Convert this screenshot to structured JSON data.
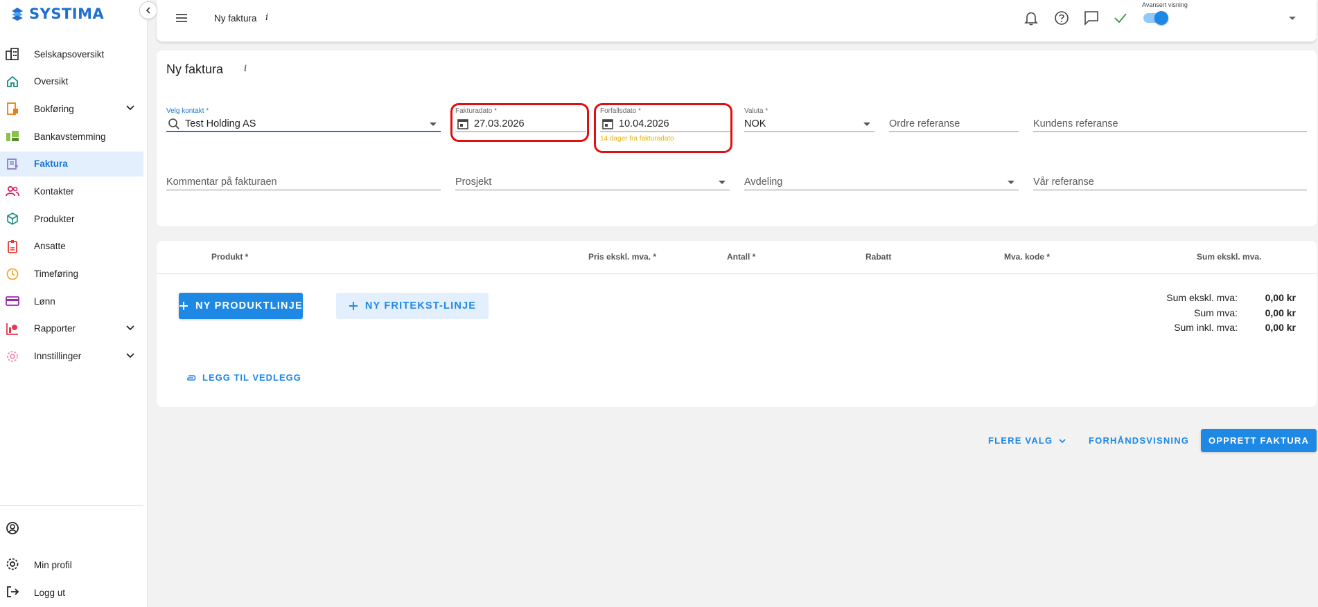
{
  "app": {
    "logo_text": "SYSTIMA"
  },
  "sidebar": {
    "items": [
      {
        "label": "Selskapsoversikt",
        "icon": "building-icon"
      },
      {
        "label": "Oversikt",
        "icon": "home-icon"
      },
      {
        "label": "Bokføring",
        "icon": "bookkeeping-icon",
        "expandable": true
      },
      {
        "label": "Bankavstemming",
        "icon": "bank-icon"
      },
      {
        "label": "Faktura",
        "icon": "invoice-icon",
        "active": true
      },
      {
        "label": "Kontakter",
        "icon": "contacts-icon"
      },
      {
        "label": "Produkter",
        "icon": "box-icon"
      },
      {
        "label": "Ansatte",
        "icon": "badge-icon"
      },
      {
        "label": "Timeføring",
        "icon": "clock-icon"
      },
      {
        "label": "Lønn",
        "icon": "card-icon"
      },
      {
        "label": "Rapporter",
        "icon": "reports-icon",
        "expandable": true
      },
      {
        "label": "Innstillinger",
        "icon": "settings-icon",
        "expandable": true
      }
    ],
    "bottom": {
      "profile_label": "Min profil",
      "logout_label": "Logg ut"
    }
  },
  "topbar": {
    "title": "Ny faktura",
    "info": "i",
    "toggle_label": "Avansert visning",
    "toggle_on": true
  },
  "form": {
    "title": "Ny faktura",
    "info": "i",
    "contact": {
      "label": "Velg kontakt *",
      "value": "Test Holding AS"
    },
    "invoice_date": {
      "label": "Fakturadato *",
      "value": "27.03.2026"
    },
    "due_date": {
      "label": "Forfallsdato *",
      "value": "10.04.2026",
      "hint": "14 dager fra fakturadato"
    },
    "currency": {
      "label": "Valuta *",
      "value": "NOK"
    },
    "order_ref": {
      "placeholder": "Ordre referanse"
    },
    "customer_ref": {
      "placeholder": "Kundens referanse"
    },
    "comment": {
      "placeholder": "Kommentar på fakturaen"
    },
    "project": {
      "placeholder": "Prosjekt"
    },
    "department": {
      "placeholder": "Avdeling"
    },
    "our_ref": {
      "placeholder": "Vår referanse"
    }
  },
  "table": {
    "headers": {
      "product": "Produkt *",
      "price": "Pris ekskl. mva. *",
      "quantity": "Antall *",
      "discount": "Rabatt",
      "vat_code": "Mva. kode *",
      "sum": "Sum ekskl. mva."
    },
    "new_product_line": "NY PRODUKTLINJE",
    "new_freetext_line": "NY FRITEKST-LINJE",
    "attach": "LEGG TIL VEDLEGG",
    "totals": {
      "excl_label": "Sum ekskl. mva:",
      "excl_value": "0,00 kr",
      "vat_label": "Sum mva:",
      "vat_value": "0,00 kr",
      "incl_label": "Sum inkl. mva:",
      "incl_value": "0,00 kr"
    }
  },
  "footer": {
    "more": "FLERE VALG",
    "preview": "FORHÅNDSVISNING",
    "create": "OPPRETT FAKTURA"
  },
  "colors": {
    "accent": "#1e88e5",
    "highlight": "#e01010",
    "hint": "#e8b400",
    "active_bg": "#e3effd"
  }
}
